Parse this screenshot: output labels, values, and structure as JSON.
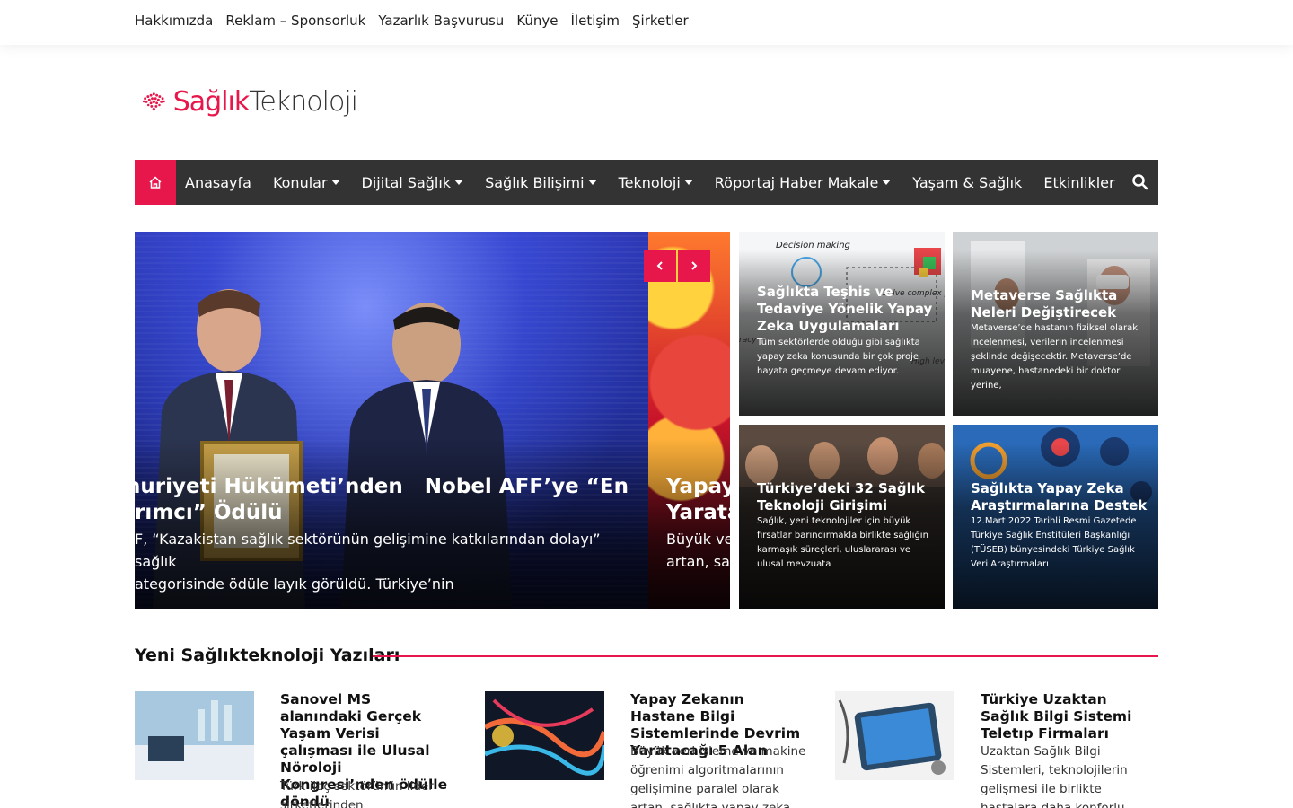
{
  "top_nav": [
    "Hakkımızda",
    "Reklam – Sponsorluk",
    "Yazarlık Başvurusu",
    "Künye",
    "İletişim",
    "Şirketler"
  ],
  "logo": {
    "part1": "Sağlık",
    "part2": "Teknoloji",
    "accent": "#e8174b"
  },
  "main_nav": {
    "home_icon": "home-icon",
    "items": [
      {
        "label": "Anasayfa",
        "dropdown": false
      },
      {
        "label": "Konular",
        "dropdown": true
      },
      {
        "label": "Dijital Sağlık",
        "dropdown": true
      },
      {
        "label": "Sağlık Bilişimi",
        "dropdown": true
      },
      {
        "label": "Teknoloji",
        "dropdown": true
      },
      {
        "label": "Röportaj Haber Makale",
        "dropdown": true
      },
      {
        "label": "Yaşam & Sağlık",
        "dropdown": false
      },
      {
        "label": "Etkinlikler",
        "dropdown": false
      }
    ],
    "search_icon": "search-icon",
    "bg": "#333333"
  },
  "hero": {
    "slide1": {
      "title_line1": "stan Cumhuriyeti Hükümeti’nden   Nobel AFF’ye “En",
      "title_line2": "rımcı” Ödülü",
      "desc_line1": "F, “Kazakistan sağlık sektörünün gelişimine katkılarından dolayı” sağlık",
      "desc_line2": "ategorisinde ödüle layık görüldü. Türkiye’nin"
    },
    "slide2": {
      "title_line1": "Yapay",
      "title_line2": "Yarata",
      "desc_line1": "Büyük ver",
      "desc_line2": "artan, sağ"
    },
    "prev_icon": "chevron-left-icon",
    "next_icon": "chevron-right-icon"
  },
  "cards": [
    {
      "title": "Sağlıkta Teşhis ve Tedaviye Yönelik Yapay Zeka Uygulamaları",
      "desc": "Tüm sektörlerde olduğu gibi  sağlıkta yapay zeka konusunda  bir çok proje hayata geçmeye devam ediyor.",
      "img_text1": "Decision making",
      "img_text2": "Solve complex p",
      "img_text3": "High lev",
      "img_text4": "racy"
    },
    {
      "title": "Metaverse Sağlıkta Neleri Değiştirecek",
      "desc": "Metaverse’de hastanın fiziksel olarak incelenmesi, verilerin incelenmesi şeklinde  değişecektir. Metaverse’de muayene, hastanedeki  bir doktor yerine,"
    },
    {
      "title": "Türkiye’deki 32 Sağlık Teknoloji Girişimi",
      "desc": "Sağlık, yeni teknolojiler  için büyük fırsatlar barındırmakla birlikte  sağlığın karmaşık süreçleri, uluslararası ve ulusal mevzuata"
    },
    {
      "title": "Sağlıkta Yapay Zeka Araştırmalarına Destek",
      "desc": "12.Mart 2022 Tarihli Resmi Gazetede Türkiye Sağlık Enstitüleri Başkanlığı (TÜSEB) bünyesindeki Türkiye Sağlık Veri Araştırmaları"
    }
  ],
  "section": {
    "title": "Yeni Sağlıkteknoloji Yazıları"
  },
  "posts": [
    {
      "title": "Sanovel MS alanındaki Gerçek Yaşam Verisi çalışması ile Ulusal Nöroloji Kongresi’nden ödülle döndü",
      "desc": "Türk ilaç sektörünün lider şirketlerinden"
    },
    {
      "title": "Yapay Zekanın Hastane Bilgi Sistemlerinde Devrim Yaratacağı 5 Alan",
      "desc": "Büyük veri işleme ve makine öğrenimi algoritmalarının gelişimine paralel olarak artan, sağlıkta yapay zeka kullanımına"
    },
    {
      "title": "Türkiye Uzaktan Sağlık Bilgi Sistemi Teletıp Firmaları",
      "desc": "Uzaktan Sağlık Bilgi Sistemleri, teknolojilerin gelişmesi ile birlikte hastalara daha konforlu, daha uygun maliyetli , sağlık"
    }
  ]
}
